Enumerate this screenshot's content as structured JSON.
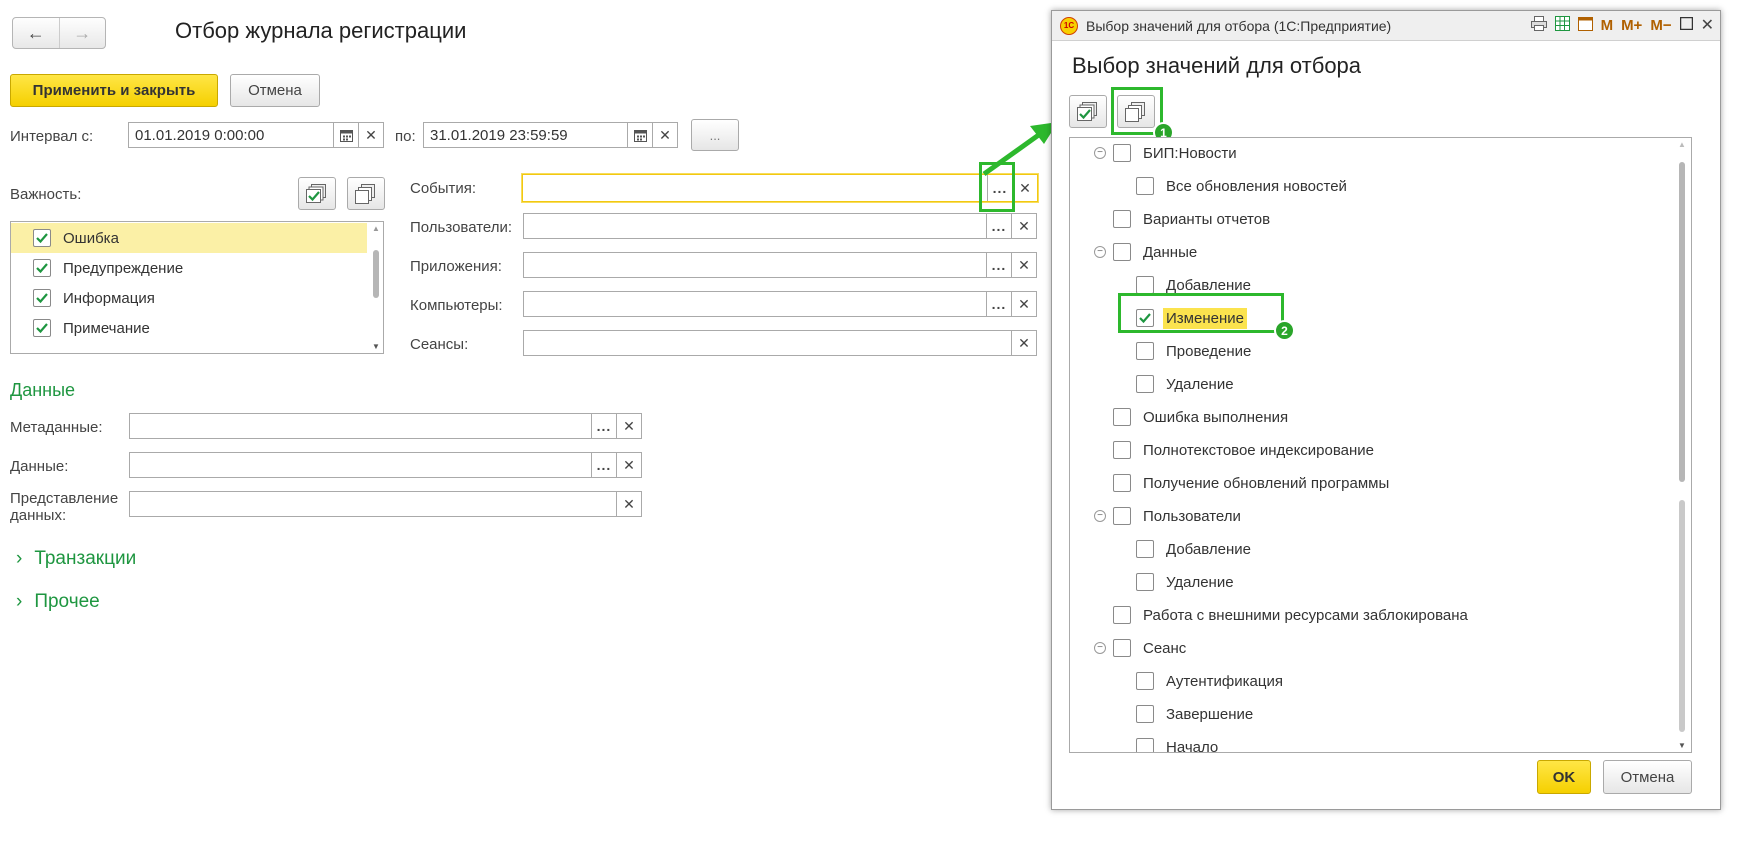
{
  "main": {
    "title": "Отбор журнала регистрации",
    "nav": {
      "back": "←",
      "forward": "→"
    },
    "apply_label": "Применить и закрыть",
    "cancel_label": "Отмена",
    "interval_label": "Интервал с:",
    "date_from": "01.01.2019  0:00:00",
    "to_label": "по:",
    "date_to": "31.01.2019 23:59:59",
    "period_btn": "...",
    "importance_label": "Важность:",
    "importance_items": [
      {
        "label": "Ошибка",
        "checked": true
      },
      {
        "label": "Предупреждение",
        "checked": true
      },
      {
        "label": "Информация",
        "checked": true
      },
      {
        "label": "Примечание",
        "checked": true
      }
    ],
    "fields": [
      {
        "label": "События:",
        "value": ""
      },
      {
        "label": "Пользователи:",
        "value": ""
      },
      {
        "label": "Приложения:",
        "value": ""
      },
      {
        "label": "Компьютеры:",
        "value": ""
      },
      {
        "label": "Сеансы:",
        "value": ""
      }
    ],
    "data_section": "Данные",
    "data_fields": [
      {
        "label": "Метаданные:",
        "value": ""
      },
      {
        "label": "Данные:",
        "value": ""
      },
      {
        "label": "Представление данных:",
        "value": ""
      }
    ],
    "transactions": "Транзакции",
    "other": "Прочее"
  },
  "dialog": {
    "window_title": "Выбор значений для отбора  (1С:Предприятие)",
    "heading": "Выбор значений для отбора",
    "app_icon": "1С",
    "toolbar_icons": [
      "print-icon",
      "spreadsheet-icon",
      "calendar-icon",
      "M",
      "M+",
      "M−",
      "maximize-icon",
      "close-icon"
    ],
    "tree": [
      {
        "label": "БИП:Новости",
        "level": 0,
        "expanded": true,
        "checked": false
      },
      {
        "label": "Все обновления новостей",
        "level": 1,
        "checked": false
      },
      {
        "label": "Варианты отчетов",
        "level": 0,
        "checked": false
      },
      {
        "label": "Данные",
        "level": 0,
        "expanded": true,
        "checked": false
      },
      {
        "label": "Добавление",
        "level": 1,
        "checked": false
      },
      {
        "label": "Изменение",
        "level": 1,
        "checked": true,
        "highlight": true
      },
      {
        "label": "Проведение",
        "level": 1,
        "checked": false
      },
      {
        "label": "Удаление",
        "level": 1,
        "checked": false
      },
      {
        "label": "Ошибка выполнения",
        "level": 0,
        "checked": false
      },
      {
        "label": "Полнотекстовое индексирование",
        "level": 0,
        "checked": false
      },
      {
        "label": "Получение обновлений программы",
        "level": 0,
        "checked": false
      },
      {
        "label": "Пользователи",
        "level": 0,
        "expanded": true,
        "checked": false
      },
      {
        "label": "Добавление",
        "level": 1,
        "checked": false
      },
      {
        "label": "Удаление",
        "level": 1,
        "checked": false
      },
      {
        "label": "Работа с внешними ресурсами заблокирована",
        "level": 0,
        "checked": false
      },
      {
        "label": "Сеанс",
        "level": 0,
        "expanded": true,
        "checked": false
      },
      {
        "label": "Аутентификация",
        "level": 1,
        "checked": false
      },
      {
        "label": "Завершение",
        "level": 1,
        "checked": false
      },
      {
        "label": "Начало",
        "level": 1,
        "checked": false
      }
    ],
    "ok_label": "OK",
    "cancel_label": "Отмена"
  },
  "annotations": {
    "badge1": "1",
    "badge2": "2"
  },
  "colors": {
    "accent_green": "#2db82d",
    "section_green": "#1e9640",
    "primary_yellow": "#f5d000",
    "highlight": "#fbe34e"
  }
}
